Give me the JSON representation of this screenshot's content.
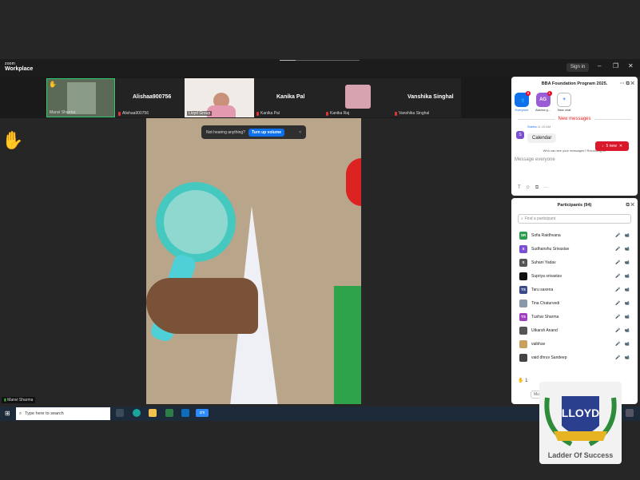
{
  "app": {
    "logo_line1": "zoom",
    "logo_line2": "Workplace",
    "signin_label": "Sign in"
  },
  "window_controls": {
    "minimize": "–",
    "restore": "❐",
    "close": "✕"
  },
  "tiles": [
    {
      "name": "Manvi Sharma"
    },
    {
      "name": "Alishaa900756",
      "display": "Alishaa900756"
    },
    {
      "name": "Lloyd Group"
    },
    {
      "name": "Kanika Pal",
      "display": "Kanika Pal"
    },
    {
      "name": "Kanika Raj"
    },
    {
      "name": "Vanshika Singhal",
      "display": "Vanshika Singhal"
    }
  ],
  "toast": {
    "text": "Not hearing anything?",
    "button": "Turn up volume",
    "close": "×"
  },
  "self_name": "Manvi Sharma",
  "chat": {
    "title": "BBA Foundation Program 2025.",
    "chips": [
      {
        "label": "Everyone",
        "initials": "",
        "badge": "5"
      },
      {
        "label": "Akshra g...",
        "initials": "AG",
        "badge": "1"
      },
      {
        "label": "New chat",
        "initials": "+"
      }
    ],
    "new_messages_label": "New messages",
    "message": {
      "sender": "Sneha",
      "time": "11:15 AM",
      "text": "Calendar",
      "avatar": "S"
    },
    "snew_label": "5 new",
    "who_can_see": "Who can see your messages? Recording on",
    "input_placeholder": "Message everyone"
  },
  "participants": {
    "title": "Participants (94)",
    "search_placeholder": "Find a participant",
    "rows": [
      {
        "name": "Sofia Raidhvana",
        "initials": "SR",
        "color": "#2e9c4f"
      },
      {
        "name": "Sudhanshu Srivastav",
        "initials": "S",
        "color": "#7b4fd1"
      },
      {
        "name": "Suhani Yadav",
        "initials": "S",
        "color": "#555555"
      },
      {
        "name": "Supriya srivastav",
        "initials": "",
        "color": "#111111"
      },
      {
        "name": "Taru saxena",
        "initials": "TS",
        "color": "#3a4a8a"
      },
      {
        "name": "Tina Chaturvedi",
        "initials": "",
        "color": "#8899aa"
      },
      {
        "name": "Tushar Sharma",
        "initials": "TS",
        "color": "#a040c0"
      },
      {
        "name": "Utkarsh Anand",
        "initials": "",
        "color": "#555555"
      },
      {
        "name": "vaibhav",
        "initials": "",
        "color": "#c9a060"
      },
      {
        "name": "vaid dhruv Sandeep",
        "initials": "",
        "color": "#444444"
      }
    ],
    "react_count": "1"
  },
  "taskbar": {
    "search_placeholder": "Type here to search"
  },
  "watermark": {
    "brand": "LLOYD",
    "tagline": "Ladder Of Success"
  }
}
